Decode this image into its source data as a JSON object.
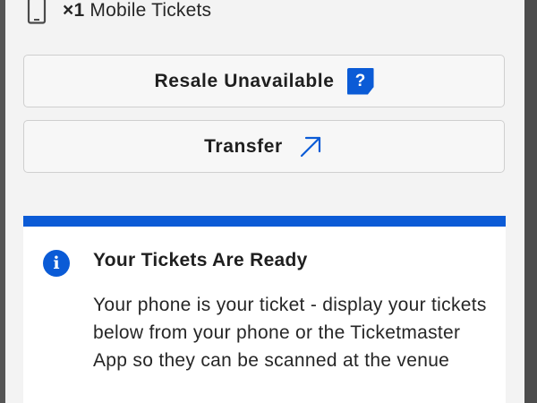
{
  "ticket_summary": {
    "quantity": "×1",
    "label": "Mobile Tickets",
    "icon": "mobile-phone-icon"
  },
  "actions": {
    "resale": {
      "label": "Resale Unavailable",
      "help_badge": "?",
      "icon": "help-badge-icon"
    },
    "transfer": {
      "label": "Transfer",
      "icon": "arrow-up-right-icon"
    }
  },
  "info_card": {
    "icon": "info-icon",
    "icon_glyph": "i",
    "title": "Your Tickets Are Ready",
    "body": "Your phone is your ticket - display your tickets below from your phone or the Ticketmaster App so they can be scanned at the venue"
  },
  "colors": {
    "accent": "#0b5bd6",
    "background": "#f3f3f3",
    "card": "#ffffff",
    "text": "#262626",
    "border": "#cfcfcf"
  }
}
